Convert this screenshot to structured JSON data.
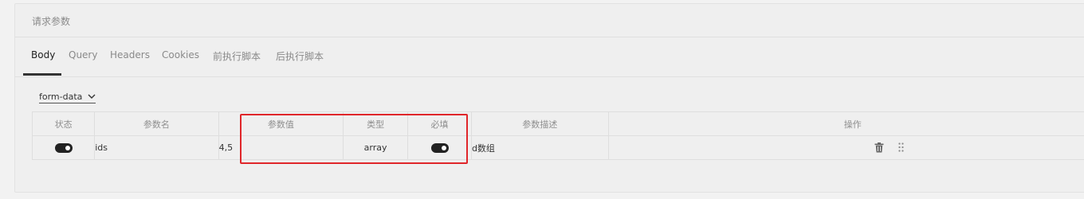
{
  "panel": {
    "title": "请求参数"
  },
  "tabs": [
    {
      "label": "Body",
      "active": true
    },
    {
      "label": "Query"
    },
    {
      "label": "Headers"
    },
    {
      "label": "Cookies"
    },
    {
      "label": "前执行脚本"
    },
    {
      "label": "后执行脚本"
    }
  ],
  "body_type": {
    "selected": "form-data",
    "icon": "chevron-down-icon"
  },
  "table": {
    "headers": {
      "status": "状态",
      "name": "参数名",
      "value": "参数值",
      "type": "类型",
      "required": "必填",
      "description": "参数描述",
      "actions": "操作"
    },
    "rows": [
      {
        "enabled": true,
        "name": "ids",
        "value": "4,5",
        "type": "array",
        "required": true,
        "description": "d数组"
      }
    ]
  },
  "annotation": {
    "color": "#e0262a"
  }
}
